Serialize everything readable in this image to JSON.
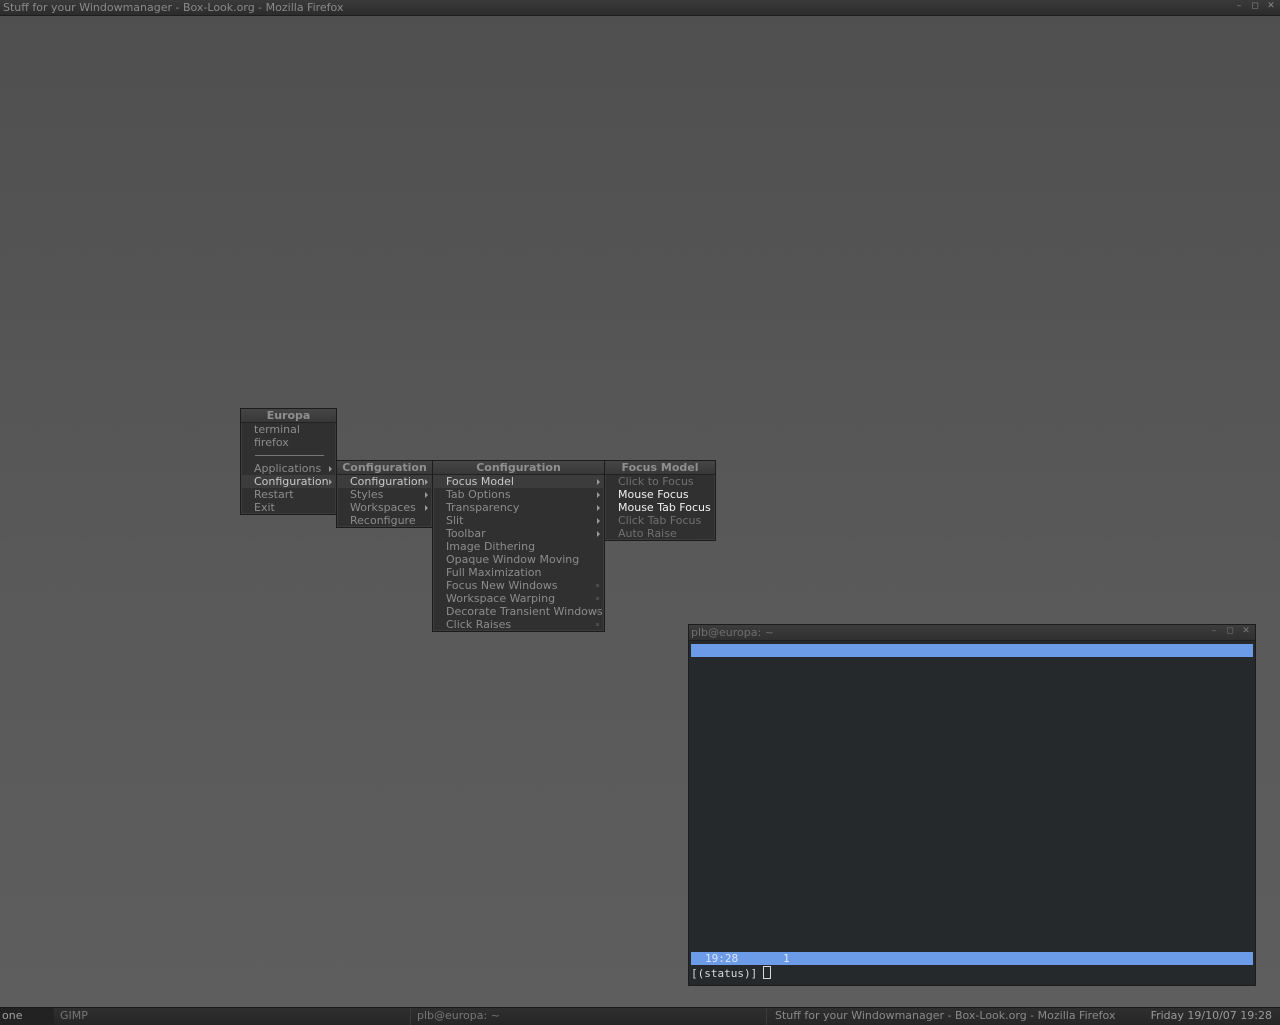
{
  "browser": {
    "title": "Stuff for your Windowmanager - Box-Look.org - Mozilla Firefox",
    "buttons": [
      "–",
      "◻",
      "✕"
    ]
  },
  "menus": {
    "root": {
      "title": "Europa",
      "items": [
        {
          "label": "terminal"
        },
        {
          "label": "firefox"
        },
        {
          "label": "Applications"
        },
        {
          "label": "Configuration"
        },
        {
          "label": "Restart"
        },
        {
          "label": "Exit"
        }
      ]
    },
    "config1": {
      "title": "Configuration",
      "items": [
        {
          "label": "Configuration"
        },
        {
          "label": "Styles"
        },
        {
          "label": "Workspaces"
        },
        {
          "label": "Reconfigure"
        }
      ]
    },
    "config2": {
      "title": "Configuration",
      "items": [
        {
          "label": "Focus Model"
        },
        {
          "label": "Tab Options"
        },
        {
          "label": "Transparency"
        },
        {
          "label": "Slit"
        },
        {
          "label": "Toolbar"
        },
        {
          "label": "Image Dithering"
        },
        {
          "label": "Opaque Window Moving"
        },
        {
          "label": "Full Maximization"
        },
        {
          "label": "Focus New Windows"
        },
        {
          "label": "Workspace Warping"
        },
        {
          "label": "Decorate Transient Windows"
        },
        {
          "label": "Click Raises"
        }
      ]
    },
    "focus": {
      "title": "Focus Model",
      "items": [
        {
          "label": "Click to Focus"
        },
        {
          "label": "Mouse Focus"
        },
        {
          "label": "Mouse Tab Focus"
        },
        {
          "label": "Click Tab Focus"
        },
        {
          "label": "Auto Raise"
        }
      ]
    }
  },
  "terminal": {
    "title": "plb@europa: ~",
    "buttons": [
      "–",
      "◻",
      "✕"
    ],
    "status_clock": "19:28",
    "status_workspace": "1",
    "prompt": "[(status)]"
  },
  "taskbar": {
    "workspace": "one",
    "tasks": [
      "GIMP",
      "plb@europa: ~",
      "Stuff for your Windowmanager - Box-Look.org - Mozilla Firefox"
    ],
    "clock": "Friday 19/10/07 19:28"
  },
  "colors": {
    "desktop": "#555555",
    "menu_bg": "#303030",
    "terminal_bg": "#26292c",
    "status_blue": "#6c9be8"
  }
}
